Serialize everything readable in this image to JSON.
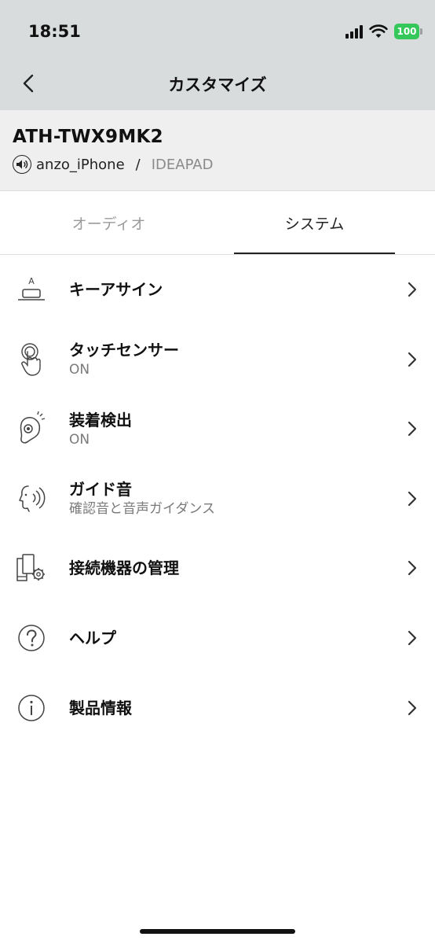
{
  "status_bar": {
    "time": "18:51",
    "battery": "100",
    "icons": [
      "cellular-signal-icon",
      "wifi-icon",
      "battery-icon"
    ],
    "battery_color": "#34c759"
  },
  "header": {
    "title": "カスタマイズ",
    "back_icon": "chevron-left-icon",
    "background": "#d8dcdc"
  },
  "device": {
    "name": "ATH-TWX9MK2",
    "connection_icon": "speaker-icon",
    "connected_device": "anzo_iPhone",
    "separator": "/",
    "other_device": "IDEAPAD"
  },
  "tabs": [
    {
      "label": "オーディオ",
      "active": false
    },
    {
      "label": "システム",
      "active": true
    }
  ],
  "menu": [
    {
      "label": "キーアサイン",
      "subtitle": "",
      "icon": "key-assign-icon"
    },
    {
      "label": "タッチセンサー",
      "subtitle": "ON",
      "icon": "touch-finger-icon"
    },
    {
      "label": "装着検出",
      "subtitle": "ON",
      "icon": "earbud-detect-icon"
    },
    {
      "label": "ガイド音",
      "subtitle": "確認音と音声ガイダンス",
      "icon": "voice-guide-icon"
    },
    {
      "label": "接続機器の管理",
      "subtitle": "",
      "icon": "device-settings-icon"
    },
    {
      "label": "ヘルプ",
      "subtitle": "",
      "icon": "help-icon"
    },
    {
      "label": "製品情報",
      "subtitle": "",
      "icon": "info-icon"
    }
  ],
  "key_assign_icon_letter": "A",
  "colors": {
    "active_tab": "#222222",
    "inactive_tab": "#9a9a9a",
    "subtitle": "#7a7a7a",
    "device_panel": "#efefef"
  }
}
